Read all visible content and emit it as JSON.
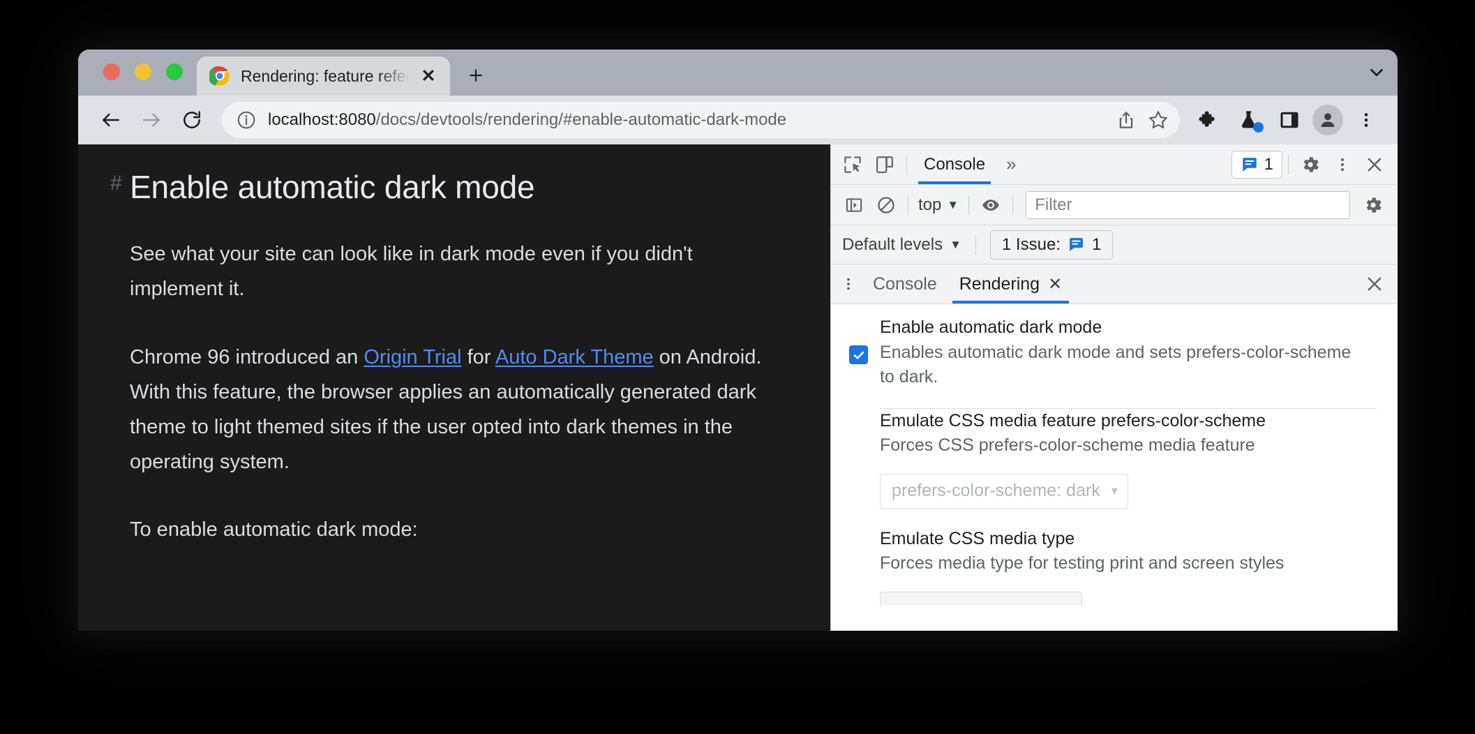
{
  "window": {
    "traffic_lights": [
      "close",
      "minimize",
      "maximize"
    ],
    "tab": {
      "favicon": "chrome-logo-icon",
      "title": "Rendering: feature reference -",
      "close_label": "✕"
    },
    "new_tab_label": "+",
    "tabstrip_chevron": "chevron-down-icon"
  },
  "toolbar": {
    "back": "back-arrow-icon",
    "forward": "forward-arrow-icon",
    "reload": "reload-icon",
    "omnibox": {
      "info_icon": "info-circle-icon",
      "host": "localhost:8080",
      "path": "/docs/devtools/rendering/#enable-automatic-dark-mode",
      "full_url": "localhost:8080/docs/devtools/rendering/#enable-automatic-dark-mode"
    },
    "share": "share-icon",
    "bookmark": "star-icon",
    "extensions": "puzzle-piece-icon",
    "experiments": "flask-icon",
    "side_panel": "side-panel-icon",
    "profile": "avatar-icon",
    "menu": "three-dot-menu-icon"
  },
  "page": {
    "heading_anchor": "#",
    "heading": "Enable automatic dark mode",
    "paragraph1": "See what your site can look like in dark mode even if you didn't implement it.",
    "paragraph2_part1": "Chrome 96 introduced an ",
    "paragraph2_link1": "Origin Trial",
    "paragraph2_part2": " for ",
    "paragraph2_link2": "Auto Dark Theme",
    "paragraph2_part3": " on Android. With this feature, the browser applies an automatically generated dark theme to light themed sites if the user opted into dark themes in the operating system.",
    "paragraph3": "To enable automatic dark mode:"
  },
  "devtools": {
    "main_toolbar": {
      "inspect": "inspect-element-icon",
      "device_toggle": "device-toolbar-icon",
      "tabs": [
        {
          "label": "Console",
          "active": true
        }
      ],
      "overflow": "»",
      "issues_badge": {
        "icon": "issue-icon",
        "count": "1"
      },
      "settings": "gear-icon",
      "more": "three-dot-menu-icon",
      "close": "close-icon"
    },
    "filter_bar": {
      "sidebar_toggle": "console-sidebar-icon",
      "clear_console": "clear-console-icon",
      "context": "top",
      "context_caret": "▼",
      "live_expression": "eye-icon",
      "filter_value": "",
      "filter_placeholder": "Filter",
      "settings": "gear-icon"
    },
    "levels_bar": {
      "levels": "Default levels",
      "levels_caret": "▼",
      "issues_text": "1 Issue:",
      "issues_icon": "issue-icon",
      "issues_count": "1"
    },
    "drawer": {
      "more": "three-dot-menu-icon",
      "tabs": [
        {
          "label": "Console",
          "active": false,
          "closable": false
        },
        {
          "label": "Rendering",
          "active": true,
          "closable": true,
          "close_label": "✕"
        }
      ],
      "close": "close-icon"
    },
    "rendering": {
      "settings": [
        {
          "title": "Enable automatic dark mode",
          "description": "Enables automatic dark mode and sets prefers-color-scheme to dark.",
          "control": "checkbox",
          "checked": true
        },
        {
          "title": "Emulate CSS media feature prefers-color-scheme",
          "description": "Forces CSS prefers-color-scheme media feature",
          "control": "select",
          "value": "prefers-color-scheme: dark",
          "disabled": true,
          "caret": "▾"
        },
        {
          "title": "Emulate CSS media type",
          "description": "Forces media type for testing print and screen styles",
          "control": "select",
          "value": ""
        }
      ]
    }
  },
  "colors": {
    "accent_blue": "#1a73e8",
    "link_blue": "#4c8df6",
    "page_background": "#1b1b1b",
    "tabstrip": "#a9aeb8",
    "toolbar": "#dee1e6",
    "devtools_chrome": "#f1f3f4"
  }
}
